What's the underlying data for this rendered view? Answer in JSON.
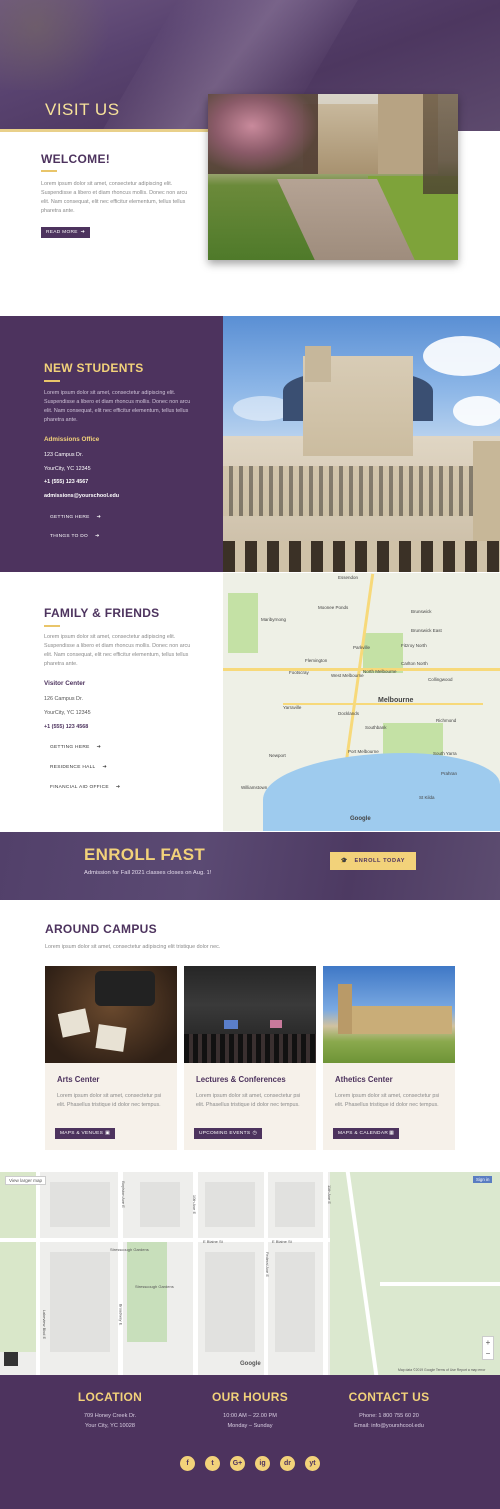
{
  "hero": {
    "title": "VISIT US"
  },
  "welcome": {
    "title": "WELCOME!",
    "text": "Lorem ipsum dolor sit amet, consectetur adipiscing elit. Suspendisse a libero et diam rhoncus mollis. Donec non arcu elit. Nam consequat, elit nec efficitur elementum, tellus tellus pharetra ante.",
    "button": "READ MORE",
    "button_icon": "arrow-right-icon"
  },
  "new_students": {
    "title": "NEW STUDENTS",
    "text": "Lorem ipsum dolor sit amet, consectetur adipiscing elit. Suspendisse a libero et diam rhoncus mollis. Donec non arcu elit. Nam consequat, elit nec efficitur elementum, tellus tellus pharetra ante.",
    "office_title": "Admissions Office",
    "address1": "123 Campus Dr.",
    "address2": "YourCity, YC 12345",
    "phone": "+1 (555) 123 4567",
    "email": "admissions@yourschool.edu",
    "links": [
      "GETTING HERE",
      "THINGS TO DO"
    ]
  },
  "family_friends": {
    "title": "FAMILY & FRIENDS",
    "text": "Lorem ipsum dolor sit amet, consectetur adipiscing elit. Suspendisse a libero et diam rhoncus mollis. Donec non arcu elit. Nam consequat, elit nec efficitur elementum, tellus tellus pharetra ante.",
    "center_title": "Visitor Center",
    "address1": "126 Campus Dr.",
    "address2": "YourCity, YC 12345",
    "phone": "+1 (555) 123 4568",
    "links": [
      "GETTING HERE",
      "RESIDENCE HALL",
      "FINANCIAL AID OFFICE"
    ]
  },
  "map1": {
    "labels": [
      "Essendon",
      "Moonee Ponds",
      "Brunswick",
      "Maribyrnong",
      "Brunswick East",
      "Parkville",
      "Fitzroy North",
      "Flemington",
      "Carlton North",
      "Footscray",
      "West Melbourne",
      "North Melbourne",
      "Melbourne",
      "Collingwood",
      "Yarraville",
      "Docklands",
      "Southbank",
      "Richmond",
      "Newport",
      "Port Melbourne",
      "South Yarra",
      "Williamstown",
      "Prahran",
      "St Kilda"
    ],
    "attribution": "Google"
  },
  "enroll": {
    "title": "ENROLL FAST",
    "subtitle": "Admission for Fall 2021 classes closes on Aug. 1!",
    "button": "ENROLL TODAY",
    "button_icon": "graduation-cap-icon"
  },
  "around": {
    "title": "AROUND CAMPUS",
    "subtitle": "Lorem ipsum dolor sit amet, consectetur adipiscing elit tristique dolor nec.",
    "cards": [
      {
        "title": "Arts Center",
        "text": "Lorem ipsum dolor sit amet, consectetur psi elit. Phasellus tristique id dolor nec tempus.",
        "button": "MAPS & VENUES",
        "icon": "chat-icon"
      },
      {
        "title": "Lectures & Conferences",
        "text": "Lorem ipsum dolor sit amet, consectetur psi elit. Phasellus tristique id dolor nec tempus.",
        "button": "UPCOMING EVENTS",
        "icon": "clock-icon"
      },
      {
        "title": "Athetics Center",
        "text": "Lorem ipsum dolor sit amet, consectetur psi elit. Phasellus tristique id dolor nec tempus.",
        "button": "MAPS & CALENDAR",
        "icon": "calendar-icon"
      }
    ]
  },
  "map2": {
    "view_larger": "View larger map",
    "sign_in": "Sign in",
    "labels": [
      "Stresscough Gardens",
      "Stresscough Gardens",
      "E Blaine St",
      "E Blaine St",
      "Lakeview Blvd E",
      "Broadway E",
      "10th Ave E",
      "Federal Ave E",
      "11th Ave E",
      "Boylston Ave E"
    ],
    "attribution": "Google",
    "footer_note": "Map data ©2019 Google  Terms of Use  Report a map error"
  },
  "footer": {
    "location": {
      "title": "LOCATION",
      "line1": "709 Honey Creek Dr.",
      "line2": "Your City, YC 10028"
    },
    "hours": {
      "title": "OUR HOURS",
      "line1": "10:00 AM – 22.00 PM",
      "line2": "Monday – Sunday"
    },
    "contact": {
      "title": "CONTACT US",
      "line1": "Phone: 1 800 755 60 20",
      "line2": "Email: info@yourshcool.edu"
    },
    "social": [
      "f",
      "t",
      "G+",
      "ig",
      "dr",
      "yt"
    ]
  },
  "colors": {
    "primary": "#4d335e",
    "accent": "#f2d27a",
    "card_bg": "#f6f1ea"
  }
}
